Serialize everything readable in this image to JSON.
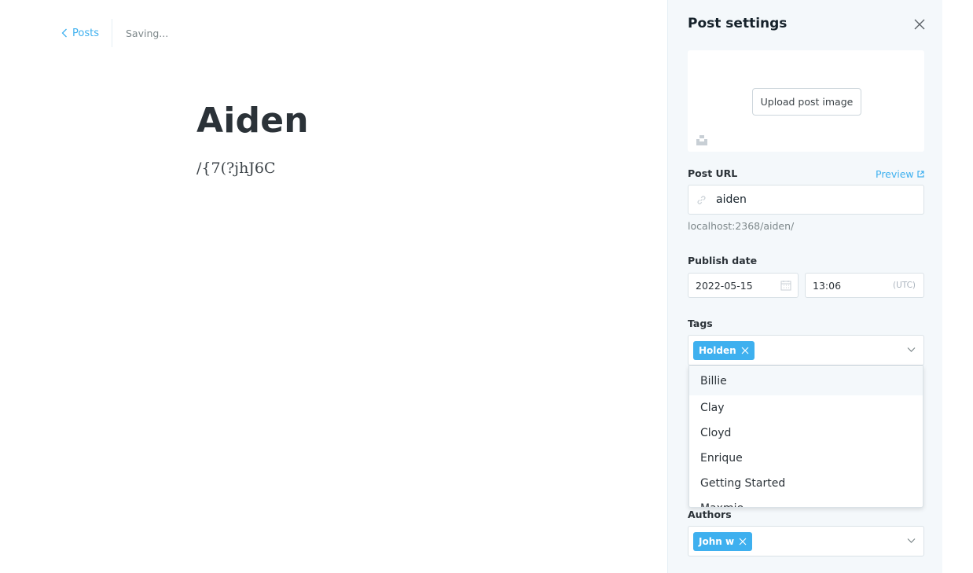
{
  "header": {
    "back_label": "Posts",
    "status": "Saving..."
  },
  "post": {
    "title": "Aiden",
    "body": "/{7(?jhJ6C"
  },
  "settings": {
    "title": "Post settings",
    "upload_label": "Upload post image",
    "url_label": "Post URL",
    "preview_label": "Preview",
    "slug": "aiden",
    "url_hint": "localhost:2368/aiden/",
    "publish_label": "Publish date",
    "date": "2022-05-15",
    "time": "13:06",
    "timezone": "(UTC)",
    "tags_label": "Tags",
    "tags": [
      "Holden"
    ],
    "tag_options": [
      "Billie",
      "Clay",
      "Cloyd",
      "Enrique",
      "Getting Started",
      "Maxmie"
    ],
    "authors_label": "Authors",
    "authors": [
      "John w"
    ]
  },
  "colors": {
    "accent": "#3eb0ef",
    "panel_bg": "#f4f8fb"
  }
}
